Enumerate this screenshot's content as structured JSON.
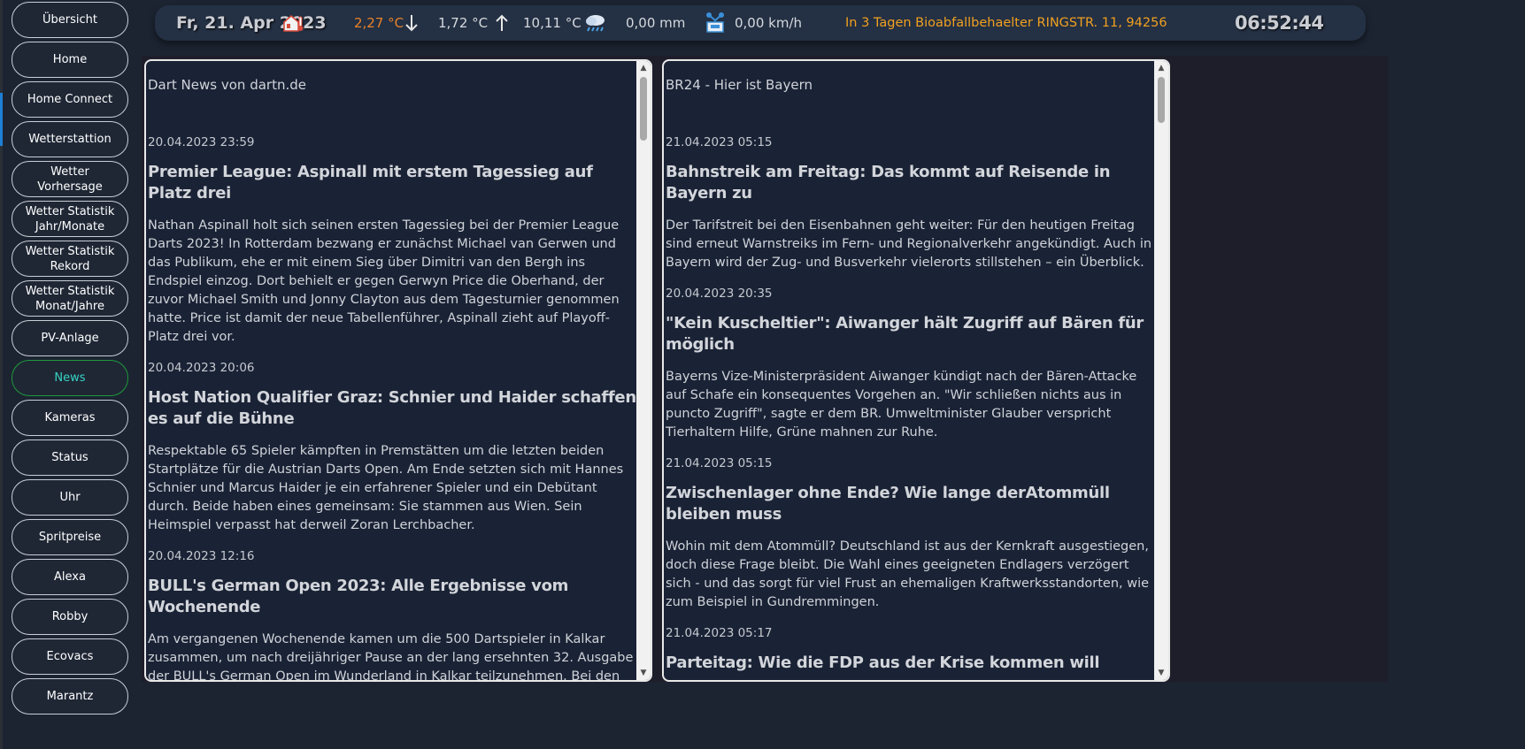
{
  "sidebar": {
    "items": [
      {
        "label": "Übersicht",
        "active": false
      },
      {
        "label": "Home",
        "active": false
      },
      {
        "label": "Home Connect",
        "active": false
      },
      {
        "label": "Wetterstattion",
        "active": false
      },
      {
        "label": "Wetter\nVorhersage",
        "active": false
      },
      {
        "label": "Wetter Statistik\nJahr/Monate",
        "active": false
      },
      {
        "label": "Wetter Statistik\nRekord",
        "active": false
      },
      {
        "label": "Wetter Statistik\nMonat/Jahre",
        "active": false
      },
      {
        "label": "PV-Anlage",
        "active": false
      },
      {
        "label": "News",
        "active": true
      },
      {
        "label": "Kameras",
        "active": false
      },
      {
        "label": "Status",
        "active": false
      },
      {
        "label": "Uhr",
        "active": false
      },
      {
        "label": "Spritpreise",
        "active": false
      },
      {
        "label": "Alexa",
        "active": false
      },
      {
        "label": "Robby",
        "active": false
      },
      {
        "label": "Ecovacs",
        "active": false
      },
      {
        "label": "Marantz",
        "active": false
      }
    ]
  },
  "topbar": {
    "date": "Fr, 21. Apr 2023",
    "temp_current": "2,27 °C",
    "temp_min": "1,72 °C",
    "temp_max": "10,11 °C",
    "rain": "0,00 mm",
    "wind": "0,00 km/h",
    "notice": "In 3 Tagen Bioabfallbehaelter RINGSTR. 11, 94256",
    "clock": "06:52:44",
    "icons": {
      "house_temp": "house-thermometer-icon",
      "arrow_down": "arrow-down-icon",
      "arrow_up": "arrow-up-icon",
      "rain": "rain-cloud-icon",
      "wind": "anemometer-icon"
    },
    "colors": {
      "temp": "#e8822b",
      "notice": "#f0a020"
    }
  },
  "feeds": {
    "left": {
      "title": "Dart News von dartn.de",
      "articles": [
        {
          "date": "20.04.2023 23:59",
          "title": "Premier League: Aspinall mit erstem Tagessieg auf Platz drei",
          "desc": "Nathan Aspinall holt sich seinen ersten Tagessieg bei der Premier League Darts 2023! In Rotterdam bezwang er zunächst Michael van Gerwen und das Publikum, ehe er mit einem Sieg über Dimitri van den Bergh ins Endspiel einzog. Dort behielt er gegen Gerwyn Price die Oberhand, der zuvor Michael Smith und Jonny Clayton aus dem Tagesturnier genommen hatte. Price ist damit der neue Tabellenführer, Aspinall zieht auf Playoff-Platz drei vor."
        },
        {
          "date": "20.04.2023 20:06",
          "title": "Host Nation Qualifier Graz: Schnier und Haider schaffen es auf die Bühne",
          "desc": "Respektable 65 Spieler kämpften in Premstätten um die letzten beiden Startplätze für die Austrian Darts Open. Am Ende setzten sich mit Hannes Schnier und Marcus Haider je ein erfahrener Spieler und ein Debütant durch. Beide haben eines gemeinsam: Sie stammen aus Wien. Sein Heimspiel verpasst hat derweil Zoran Lerchbacher."
        },
        {
          "date": "20.04.2023 12:16",
          "title": "BULL's German Open 2023: Alle Ergebnisse vom Wochenende",
          "desc": "Am vergangenen Wochenende kamen um die 500 Dartspieler in Kalkar zusammen, um nach dreijähriger Pause an der lang ersehnten 32. Ausgabe der BULL's German Open im Wunderland in Kalkar teilzunehmen. Bei den"
        }
      ]
    },
    "right": {
      "title": "BR24 - Hier ist Bayern",
      "articles": [
        {
          "date": "21.04.2023 05:15",
          "title": "Bahnstreik am Freitag: Das kommt auf Reisende in Bayern zu",
          "desc": "Der Tarifstreit bei den Eisenbahnen geht weiter: Für den heutigen Freitag sind erneut Warnstreiks im Fern- und Regionalverkehr angekündigt. Auch in Bayern wird der Zug- und Busverkehr vielerorts stillstehen – ein Überblick."
        },
        {
          "date": "20.04.2023 20:35",
          "title": "\"Kein Kuscheltier\": Aiwanger hält Zugriff auf Bären für möglich",
          "desc": "Bayerns Vize-Ministerpräsident Aiwanger kündigt nach der Bären-Attacke auf Schafe ein konsequentes Vorgehen an. \"Wir schließen nichts aus in puncto Zugriff\", sagte er dem BR. Umweltminister Glauber verspricht Tierhaltern Hilfe, Grüne mahnen zur Ruhe."
        },
        {
          "date": "21.04.2023 05:15",
          "title": "Zwischenlager ohne Ende? Wie lange derAtommüll bleiben muss",
          "desc": "Wohin mit dem Atommüll? Deutschland ist aus der Kernkraft ausgestiegen, doch diese Frage bleibt. Die Wahl eines geeigneten Endlagers verzögert sich - und das sorgt für viel Frust an ehemaligen Kraftwerksstandorten, wie zum Beispiel in Gundremmingen."
        },
        {
          "date": "21.04.2023 05:17",
          "title": "Parteitag: Wie die FDP aus der Krise kommen will",
          "desc": ""
        }
      ]
    }
  }
}
